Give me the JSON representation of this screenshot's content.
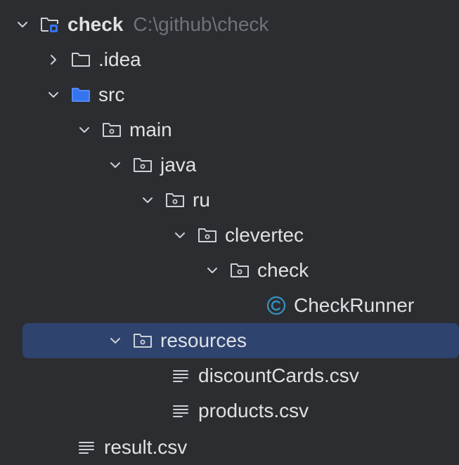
{
  "tree": {
    "root": {
      "name": "check",
      "path": "C:\\github\\check"
    },
    "items": [
      {
        "label": ".idea"
      },
      {
        "label": "src"
      },
      {
        "label": "main"
      },
      {
        "label": "java"
      },
      {
        "label": "ru"
      },
      {
        "label": "clevertec"
      },
      {
        "label": "check"
      },
      {
        "label": "CheckRunner"
      },
      {
        "label": "resources"
      },
      {
        "label": "discountCards.csv"
      },
      {
        "label": "products.csv"
      },
      {
        "label": "result.csv"
      }
    ]
  },
  "colors": {
    "background": "#2b2d30",
    "selection": "#2e436e",
    "text": "#dfe1e5",
    "muted_text": "#6f737a",
    "source_folder": "#548af7",
    "class_icon": "#3592c4"
  },
  "icons": {
    "expanded": "chevron-down-icon",
    "collapsed": "chevron-right-icon",
    "module": "module-folder-icon",
    "folder": "folder-icon",
    "source_folder": "source-folder-icon",
    "package": "package-folder-icon",
    "class": "java-class-icon",
    "text_file": "text-file-icon"
  }
}
